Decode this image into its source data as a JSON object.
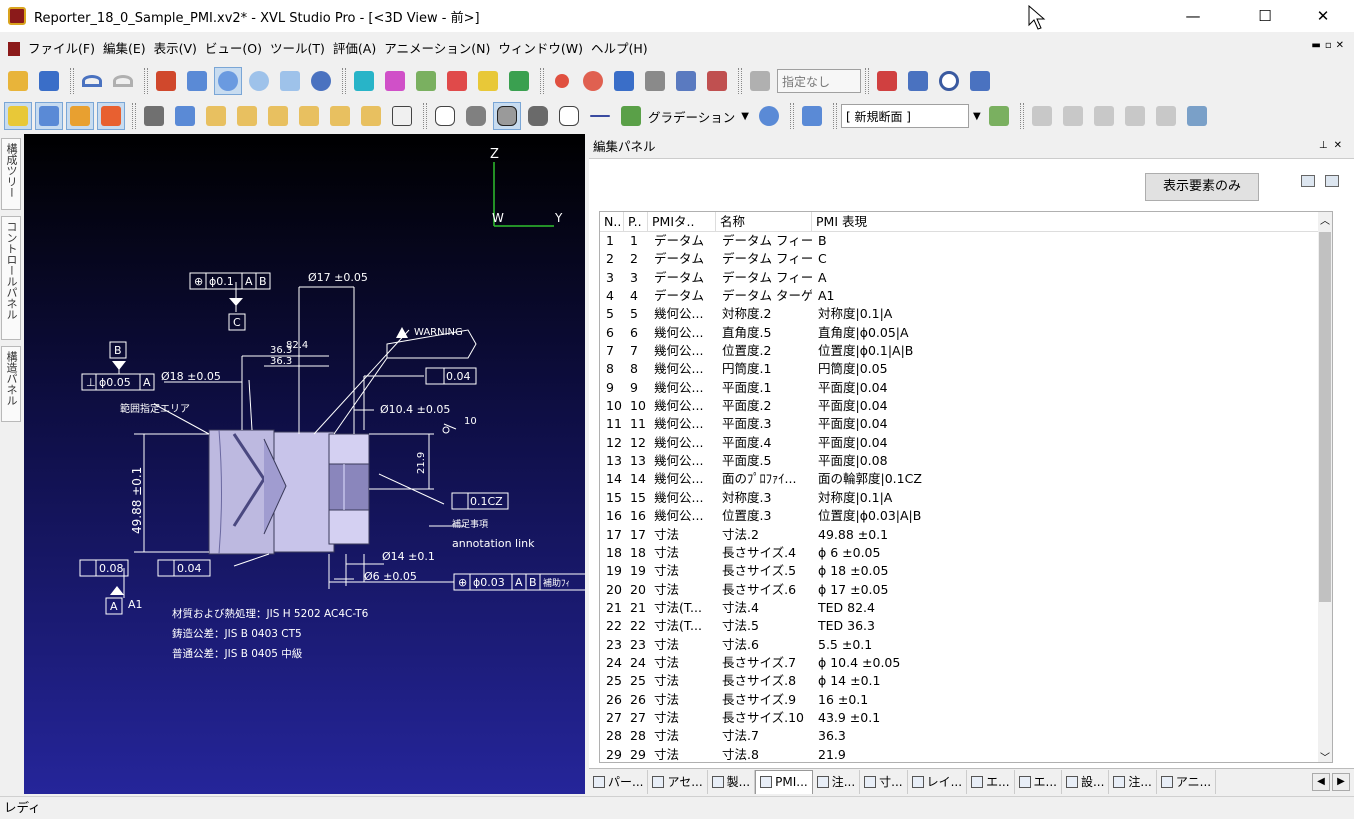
{
  "window": {
    "title": "Reporter_18_0_Sample_PMI.xv2* - XVL Studio Pro - [<3D View - 前>]",
    "minimize": "—",
    "maximize": "☐",
    "close": "✕"
  },
  "menu": [
    "ファイル(F)",
    "編集(E)",
    "表示(V)",
    "ビュー(O)",
    "ツール(T)",
    "評価(A)",
    "アニメーション(N)",
    "ウィンドウ(W)",
    "ヘルプ(H)"
  ],
  "toolbar": {
    "spec_combo": "指定なし",
    "gradient_label": "グラデーション",
    "section_combo": "[ 新規断面 ]"
  },
  "side_tabs": [
    "構成ツリー",
    "コントロールパネル",
    "構造パネル"
  ],
  "viewport": {
    "axes": {
      "z": "Z",
      "w": "W",
      "y": "Y"
    },
    "annotations": {
      "fcf_top": [
        "⊕",
        "ϕ0.1",
        "A",
        "B"
      ],
      "datum_c": "C",
      "dim_17": "Ø17 ±0.05",
      "warning": "WARNING",
      "datum_b": "B",
      "fcf_perp": [
        "⊥",
        "ϕ0.05",
        "A"
      ],
      "dim_18": "Ø18 ±0.05",
      "dim_824": "82.4",
      "dim_363a": "36.3",
      "dim_363b": "36.3",
      "flat_004_right": "0.04",
      "area_label": "範囲指定エリア",
      "dim_104": "Ø10.4 ±0.05",
      "dim_10": "10",
      "dim_219": "21.9",
      "dim_4988": "49.88 ±0.1",
      "profile_01cz": "0.1CZ",
      "supp": "補足事項",
      "annotation_link": "annotation link",
      "flat_008": "0.08",
      "flat_004_bottom": "0.04",
      "dim_14": "Ø14 ±0.1",
      "dim_6": "Ø6 ±0.05",
      "fcf_pos": [
        "⊕",
        "ϕ0.03",
        "A",
        "B"
      ],
      "pos_tail": "補助ﾌｨ",
      "datum_a": "A",
      "a1": "A1",
      "note1": "材質および熱処理：JIS H 5202 AC4C-T6",
      "note2": "鋳造公差：JIS B 0403 CT5",
      "note3": "普通公差：JIS B 0405 中級"
    }
  },
  "panel": {
    "title": "編集パネル",
    "filter_button": "表示要素のみ",
    "columns": [
      "N..",
      "P..",
      "PMIタ..",
      "名称",
      "PMI 表現"
    ],
    "rows": [
      [
        "1",
        "1",
        "データム",
        "データム フィーチ...",
        "B"
      ],
      [
        "2",
        "2",
        "データム",
        "データム フィーチ...",
        "C"
      ],
      [
        "3",
        "3",
        "データム",
        "データム フィーチ...",
        "A"
      ],
      [
        "4",
        "4",
        "データム",
        "データム ターゲ...",
        "A1"
      ],
      [
        "5",
        "5",
        "幾何公...",
        "対称度.2",
        "対称度|0.1|A"
      ],
      [
        "6",
        "6",
        "幾何公...",
        "直角度.5",
        "直角度|ϕ0.05|A"
      ],
      [
        "7",
        "7",
        "幾何公...",
        "位置度.2",
        "位置度|ϕ0.1|A|B"
      ],
      [
        "8",
        "8",
        "幾何公...",
        "円筒度.1",
        "円筒度|0.05"
      ],
      [
        "9",
        "9",
        "幾何公...",
        "平面度.1",
        "平面度|0.04"
      ],
      [
        "10",
        "10",
        "幾何公...",
        "平面度.2",
        "平面度|0.04"
      ],
      [
        "11",
        "11",
        "幾何公...",
        "平面度.3",
        "平面度|0.04"
      ],
      [
        "12",
        "12",
        "幾何公...",
        "平面度.4",
        "平面度|0.04"
      ],
      [
        "13",
        "13",
        "幾何公...",
        "平面度.5",
        "平面度|0.08"
      ],
      [
        "14",
        "14",
        "幾何公...",
        "面のﾌﾟﾛﾌｧｲ...",
        "面の輪郭度|0.1CZ"
      ],
      [
        "15",
        "15",
        "幾何公...",
        "対称度.3",
        "対称度|0.1|A"
      ],
      [
        "16",
        "16",
        "幾何公...",
        "位置度.3",
        "位置度|ϕ0.03|A|B"
      ],
      [
        "17",
        "17",
        "寸法",
        "寸法.2",
        "49.88 ±0.1"
      ],
      [
        "18",
        "18",
        "寸法",
        "長さサイズ.4",
        "ϕ 6 ±0.05"
      ],
      [
        "19",
        "19",
        "寸法",
        "長さサイズ.5",
        "ϕ 18 ±0.05"
      ],
      [
        "20",
        "20",
        "寸法",
        "長さサイズ.6",
        "ϕ 17 ±0.05"
      ],
      [
        "21",
        "21",
        "寸法(T...",
        "寸法.4",
        "TED 82.4"
      ],
      [
        "22",
        "22",
        "寸法(T...",
        "寸法.5",
        "TED 36.3"
      ],
      [
        "23",
        "23",
        "寸法",
        "寸法.6",
        "5.5 ±0.1"
      ],
      [
        "24",
        "24",
        "寸法",
        "長さサイズ.7",
        "ϕ 10.4 ±0.05"
      ],
      [
        "25",
        "25",
        "寸法",
        "長さサイズ.8",
        "ϕ 14 ±0.1"
      ],
      [
        "26",
        "26",
        "寸法",
        "長さサイズ.9",
        "16 ±0.1"
      ],
      [
        "27",
        "27",
        "寸法",
        "長さサイズ.10",
        "43.9 ±0.1"
      ],
      [
        "28",
        "28",
        "寸法",
        "寸法.7",
        "36.3"
      ],
      [
        "29",
        "29",
        "寸法",
        "寸法.8",
        "21.9"
      ]
    ]
  },
  "bottom_tabs": [
    "パー...",
    "アセ...",
    "製...",
    "PMI...",
    "注...",
    "寸...",
    "レイ...",
    "エ...",
    "エ...",
    "設...",
    "注...",
    "アニ..."
  ],
  "active_bottom_tab": "PMI...",
  "status": "レディ",
  "colors": {
    "viewport_top": "#000000",
    "viewport_bottom": "#25259a",
    "part": "#c8c4e8",
    "accent": "#7aa6d6"
  }
}
